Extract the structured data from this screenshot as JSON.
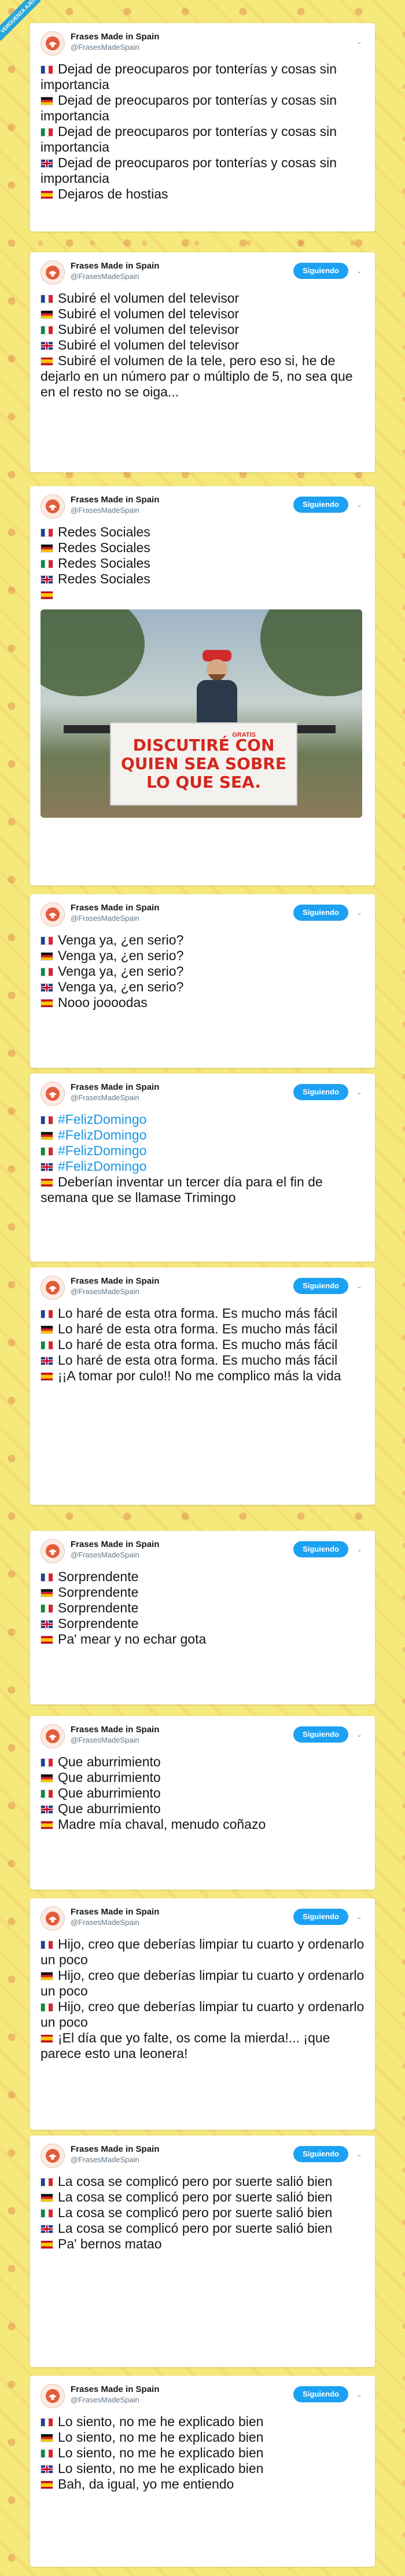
{
  "site_badge": "VERGUENZA AJENA",
  "account": {
    "display_name": "Frases Made in Spain",
    "handle": "@FrasesMadeSpain",
    "follow_label": "Siguiendo"
  },
  "tweets": [
    {
      "show_follow": false,
      "lines": [
        {
          "flag": "fr",
          "text": "Dejad de preocuparos por tonterías y cosas sin importancia"
        },
        {
          "flag": "de",
          "text": "Dejad de preocuparos por tonterías y cosas sin importancia"
        },
        {
          "flag": "it",
          "text": "Dejad de preocuparos por tonterías y cosas sin importancia"
        },
        {
          "flag": "gb",
          "text": "Dejad de preocuparos por tonterías y cosas sin importancia"
        },
        {
          "flag": "es",
          "text": "Dejaros de hostias"
        }
      ]
    },
    {
      "show_follow": true,
      "lines": [
        {
          "flag": "fr",
          "text": "Subiré el volumen del televisor"
        },
        {
          "flag": "de",
          "text": "Subiré el volumen del televisor"
        },
        {
          "flag": "it",
          "text": "Subiré el volumen del televisor"
        },
        {
          "flag": "gb",
          "text": "Subiré el volumen del televisor"
        },
        {
          "flag": "es",
          "text": "Subiré el volumen de la tele, pero eso si, he de dejarlo en un número par o múltiplo de 5, no sea que en el resto no se oiga..."
        }
      ]
    },
    {
      "show_follow": true,
      "lines": [
        {
          "flag": "fr",
          "text": "Redes Sociales"
        },
        {
          "flag": "de",
          "text": "Redes Sociales"
        },
        {
          "flag": "it",
          "text": "Redes Sociales"
        },
        {
          "flag": "gb",
          "text": "Redes Sociales"
        },
        {
          "flag": "es",
          "text": ""
        }
      ],
      "photo": {
        "sign_text": "DISCUTIRÉ CON QUIEN SEA SOBRE LO QUE SEA.",
        "sign_badge": "GRATIS"
      }
    },
    {
      "show_follow": true,
      "lines": [
        {
          "flag": "fr",
          "text": "Venga ya, ¿en serio?"
        },
        {
          "flag": "de",
          "text": "Venga ya, ¿en serio?"
        },
        {
          "flag": "it",
          "text": "Venga ya, ¿en serio?"
        },
        {
          "flag": "gb",
          "text": "Venga ya, ¿en serio?"
        },
        {
          "flag": "es",
          "text": "Nooo joooodas"
        }
      ]
    },
    {
      "show_follow": true,
      "lines": [
        {
          "flag": "fr",
          "text": "#FelizDomingo",
          "hashtag": true
        },
        {
          "flag": "de",
          "text": "#FelizDomingo",
          "hashtag": true
        },
        {
          "flag": "it",
          "text": "#FelizDomingo",
          "hashtag": true
        },
        {
          "flag": "gb",
          "text": "#FelizDomingo",
          "hashtag": true
        },
        {
          "flag": "es",
          "text": "Deberían inventar un tercer día para el fin de semana que se llamase Trimingo"
        }
      ]
    },
    {
      "show_follow": true,
      "lines": [
        {
          "flag": "fr",
          "text": "Lo haré de esta otra forma. Es mucho más fácil"
        },
        {
          "flag": "de",
          "text": "Lo haré de esta otra forma. Es mucho más fácil"
        },
        {
          "flag": "it",
          "text": "Lo haré de esta otra forma. Es mucho más fácil"
        },
        {
          "flag": "gb",
          "text": "Lo haré de esta otra forma. Es mucho más fácil"
        },
        {
          "flag": "es",
          "text": "¡¡A tomar por culo!! No me complico más la vida"
        }
      ]
    },
    {
      "show_follow": true,
      "lines": [
        {
          "flag": "fr",
          "text": "Sorprendente"
        },
        {
          "flag": "de",
          "text": "Sorprendente"
        },
        {
          "flag": "it",
          "text": "Sorprendente"
        },
        {
          "flag": "gb",
          "text": "Sorprendente"
        },
        {
          "flag": "es",
          "text": "Pa' mear y no echar gota"
        }
      ]
    },
    {
      "show_follow": true,
      "lines": [
        {
          "flag": "fr",
          "text": "Que aburrimiento"
        },
        {
          "flag": "de",
          "text": "Que aburrimiento"
        },
        {
          "flag": "it",
          "text": "Que aburrimiento"
        },
        {
          "flag": "gb",
          "text": "Que aburrimiento"
        },
        {
          "flag": "es",
          "text": "Madre mía chaval, menudo coñazo"
        }
      ]
    },
    {
      "show_follow": true,
      "lines": [
        {
          "flag": "fr",
          "text": "Hijo, creo que deberías limpiar tu cuarto y ordenarlo un poco"
        },
        {
          "flag": "de",
          "text": "Hijo, creo que deberías limpiar tu cuarto y ordenarlo un poco"
        },
        {
          "flag": "it",
          "text": "Hijo, creo que deberías limpiar tu cuarto y ordenarlo un poco"
        },
        {
          "flag": "es",
          "text": "¡El día que yo falte, os come la mierda!... ¡que parece esto una leonera!"
        }
      ]
    },
    {
      "show_follow": true,
      "lines": [
        {
          "flag": "fr",
          "text": "La cosa se complicó pero por suerte salió bien"
        },
        {
          "flag": "de",
          "text": "La cosa se complicó pero por suerte salió bien"
        },
        {
          "flag": "it",
          "text": "La cosa se complicó pero por suerte salió bien"
        },
        {
          "flag": "gb",
          "text": "La cosa se complicó pero por suerte salió bien"
        },
        {
          "flag": "es",
          "text": "Pa' bernos matao"
        }
      ]
    },
    {
      "show_follow": true,
      "lines": [
        {
          "flag": "fr",
          "text": "Lo siento, no me he explicado bien"
        },
        {
          "flag": "de",
          "text": "Lo siento, no me he explicado bien"
        },
        {
          "flag": "it",
          "text": "Lo siento, no me he explicado bien"
        },
        {
          "flag": "gb",
          "text": "Lo siento, no me he explicado bien"
        },
        {
          "flag": "es",
          "text": "Bah, da igual, yo me entiendo"
        }
      ]
    }
  ]
}
